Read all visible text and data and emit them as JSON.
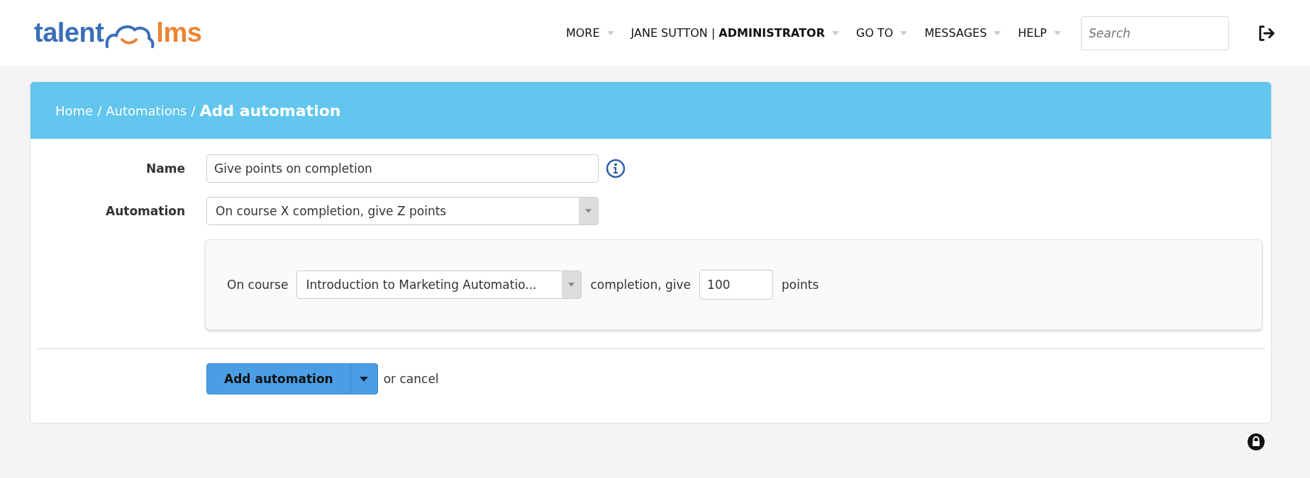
{
  "logo": {
    "first": "talent",
    "second": "lms"
  },
  "nav": [
    {
      "label": "MORE"
    },
    {
      "label": "JANE SUTTON | **ADMINISTRATOR**"
    },
    {
      "label": "GO TO"
    },
    {
      "label": "MESSAGES"
    },
    {
      "label": "HELP"
    }
  ],
  "search": {
    "placeholder": "Search"
  },
  "breadcrumb": {
    "items": [
      "Home",
      "Automations"
    ],
    "current": "Add automation",
    "separator": "/"
  },
  "form": {
    "name_label": "Name",
    "name_value": "Give points on completion",
    "automation_label": "Automation",
    "automation_value": "On course X completion, give Z points"
  },
  "rule": {
    "prefix": "On course",
    "course": "Introduction to Marketing Automatio...",
    "middle": "completion, give",
    "points": "100",
    "suffix": "points"
  },
  "actions": {
    "submit": "Add automation",
    "cancel": "or cancel"
  }
}
